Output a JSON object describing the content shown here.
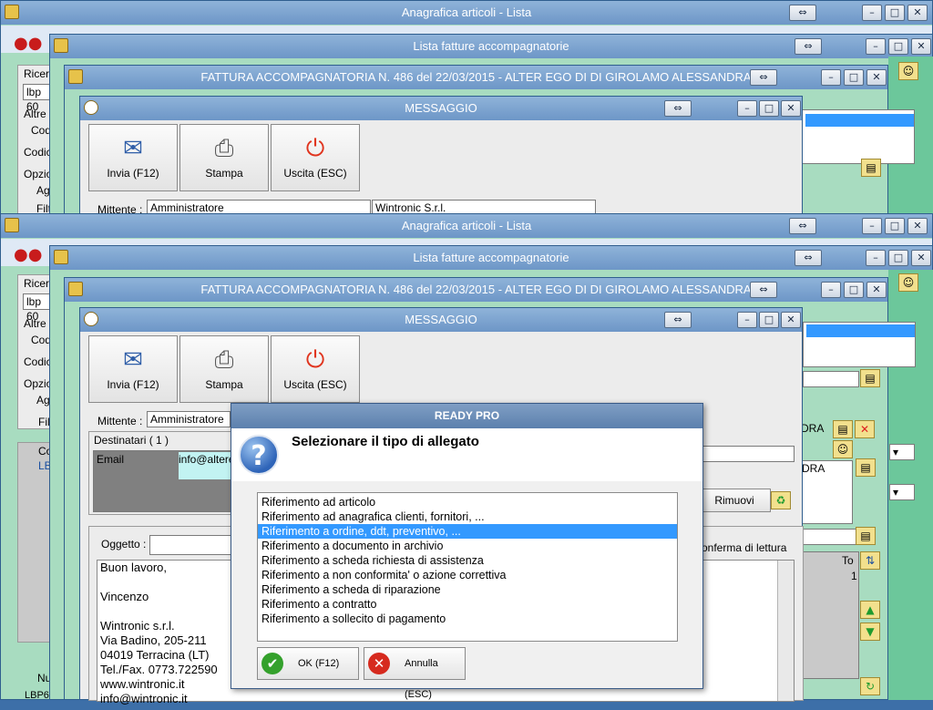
{
  "windows": {
    "main_title": "Anagrafica articoli  - Lista",
    "invoices_title": "Lista fatture accompagnatorie",
    "invoice_title": "FATTURA ACCOMPAGNATORIA N. 486 del 22/03/2015 - ALTER EGO DI DI GIROLAMO ALESSANDRA",
    "message_title": "MESSAGGIO"
  },
  "left_panel": {
    "ricerca_label": "Ricerc",
    "ricerca_value": "lbp 60",
    "altre_label": "Altre",
    "cod_label": "Cod",
    "codice_label": "Codic",
    "opzioni_label": "Opzio",
    "ag_label": "Ag",
    "filtra_label": "Filt",
    "co_header": "Co",
    "lb_cell": "LB",
    "nu_label": "Nu",
    "lbp_footer": "LBP60"
  },
  "message": {
    "buttons": {
      "invia": "Invia (F12)",
      "stampa": "Stampa",
      "uscita": "Uscita (ESC)"
    },
    "mittente_label": "Mittente :",
    "mittente_value": "Amministratore",
    "mittente_company": "Wintronic S.r.l.",
    "destinatari_label": "Destinatari ( 1 )",
    "email_label": "Email",
    "email_value": "info@altere",
    "rimuovi_label": "Rimuovi",
    "oggetto_label": "Oggetto :",
    "conferma_label": "onferma di lettura",
    "body_lines": [
      "Buon lavoro,",
      "",
      "Vincenzo",
      "",
      "Wintronic s.r.l.",
      "Via Badino, 205-211",
      "04019 Terracina (LT)",
      "Tel./Fax. 0773.722590",
      "www.wintronic.it",
      "info@wintronic.it"
    ]
  },
  "invoice_side": {
    "dra_1": "DRA",
    "dra_2": "DRA",
    "to_header": "To",
    "to_value": "1"
  },
  "dialog": {
    "title": "READY PRO",
    "prompt": "Selezionare il tipo di allegato",
    "options": [
      "Riferimento ad articolo",
      "Riferimento ad anagrafica clienti, fornitori, ...",
      "Riferimento a ordine, ddt, preventivo, ...",
      "Riferimento a documento in archivio",
      "Riferimento a scheda richiesta di assistenza",
      "Riferimento a non conformita' o azione correttiva",
      "Riferimento a scheda di riparazione",
      "Riferimento a contratto",
      "Riferimento a sollecito di pagamento"
    ],
    "selected_index": 2,
    "ok_label": "OK (F12)",
    "cancel_label": "Annulla (ESC)"
  },
  "colors": {
    "window_green": "#a8dcc0",
    "titlebar_blue": "#6d96c7",
    "selection": "#3399ff"
  }
}
